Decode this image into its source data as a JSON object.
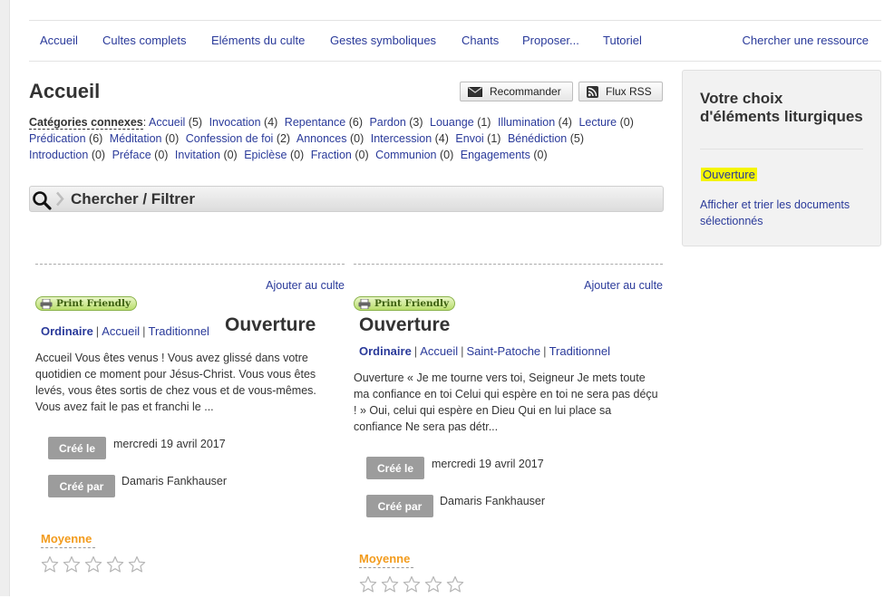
{
  "topnav": {
    "items": [
      "Accueil",
      "Cultes complets",
      "Eléments du culte",
      "Gestes symboliques",
      "Chants",
      "Proposer...",
      "Tutoriel"
    ],
    "search_link": "Chercher une ressource"
  },
  "header": {
    "title": "Accueil",
    "recommend_label": "Recommander",
    "rss_label": "Flux RSS"
  },
  "categories": {
    "label": "Catégories connexes",
    "items": [
      {
        "name": "Accueil",
        "count": "(5)"
      },
      {
        "name": "Invocation",
        "count": "(4)"
      },
      {
        "name": "Repentance",
        "count": "(6)"
      },
      {
        "name": "Pardon",
        "count": "(3)"
      },
      {
        "name": "Louange",
        "count": "(1)"
      },
      {
        "name": "Illumination",
        "count": "(4)"
      },
      {
        "name": "Lecture",
        "count": "(0)"
      },
      {
        "name": "Prédication",
        "count": "(6)"
      },
      {
        "name": "Méditation",
        "count": "(0)"
      },
      {
        "name": "Confession de foi",
        "count": "(2)"
      },
      {
        "name": "Annonces",
        "count": "(0)"
      },
      {
        "name": "Intercession",
        "count": "(4)"
      },
      {
        "name": "Envoi",
        "count": "(1)"
      },
      {
        "name": "Bénédiction",
        "count": "(5)"
      },
      {
        "name": "Introduction",
        "count": "(0)"
      },
      {
        "name": "Préface",
        "count": "(0)"
      },
      {
        "name": "Invitation",
        "count": "(0)"
      },
      {
        "name": "Epiclèse",
        "count": "(0)"
      },
      {
        "name": "Fraction",
        "count": "(0)"
      },
      {
        "name": "Communion",
        "count": "(0)"
      },
      {
        "name": "Engagements",
        "count": "(0)"
      }
    ]
  },
  "search_bar": {
    "title": "Chercher / Filtrer"
  },
  "sidebar": {
    "title": "Votre choix d'éléments liturgiques",
    "selected": "Ouverture",
    "show_link": "Afficher et trier les documents sélectionnés"
  },
  "cards": [
    {
      "add_label": "Ajouter au culte",
      "print_label": "Print Friendly",
      "tags": [
        "Ordinaire",
        "Accueil",
        "Traditionnel"
      ],
      "title": "Ouverture",
      "excerpt": "Accueil Vous êtes venus ! Vous avez glissé dans votre quotidien ce moment pour Jésus-Christ. Vous vous êtes levés, vous êtes sortis de chez vous et de vous-mêmes. Vous avez fait le pas et franchi le ...",
      "created_label": "Créé le",
      "created_value": "mercredi 19 avril 2017",
      "author_label": "Créé par",
      "author_value": "Damaris Fankhauser",
      "rating_label": "Moyenne",
      "rating": 0
    },
    {
      "add_label": "Ajouter au culte",
      "print_label": "Print Friendly",
      "tags": [
        "Ordinaire",
        "Accueil",
        "Saint-Patoche",
        "Traditionnel"
      ],
      "title": "Ouverture",
      "excerpt": "Ouverture « Je me tourne vers toi, Seigneur Je mets toute ma confiance en toi Celui qui espère en toi ne sera pas déçu ! » Oui, celui qui espère en Dieu Qui en lui place sa confiance Ne sera pas détr...",
      "created_label": "Créé le",
      "created_value": "mercredi 19 avril 2017",
      "author_label": "Créé par",
      "author_value": "Damaris Fankhauser",
      "rating_label": "Moyenne",
      "rating": 0
    }
  ]
}
